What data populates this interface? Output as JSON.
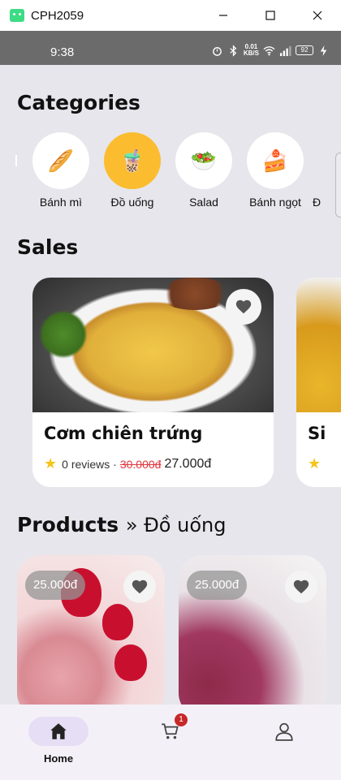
{
  "window": {
    "title": "CPH2059"
  },
  "statusbar": {
    "time": "9:38",
    "kbs_value": "0.01",
    "kbs_unit": "KB/S",
    "battery": "92"
  },
  "categories": {
    "title": "Categories",
    "items": [
      {
        "label": "Bánh mì",
        "icon": "🥖",
        "active": false
      },
      {
        "label": "Đồ uống",
        "icon": "🧋",
        "active": true
      },
      {
        "label": "Salad",
        "icon": "🥗",
        "active": false
      },
      {
        "label": "Bánh ngọt",
        "icon": "🍰",
        "active": false
      },
      {
        "label": "Đ",
        "icon": "",
        "active": false
      }
    ]
  },
  "sales": {
    "title": "Sales",
    "items": [
      {
        "name": "Cơm chiên trứng",
        "reviews": "0 reviews ·",
        "old_price": "30.000đ",
        "new_price": "27.000đ"
      },
      {
        "name": "Si"
      }
    ]
  },
  "products": {
    "title": "Products",
    "crumb": "» Đồ uống",
    "items": [
      {
        "price": "25.000đ"
      },
      {
        "price": "25.000đ"
      }
    ]
  },
  "nav": {
    "home_label": "Home",
    "cart_count": "1"
  },
  "colors": {
    "accent": "#fbbd2f",
    "sale_red": "#e0383e",
    "nav_active": "#e6def5"
  }
}
